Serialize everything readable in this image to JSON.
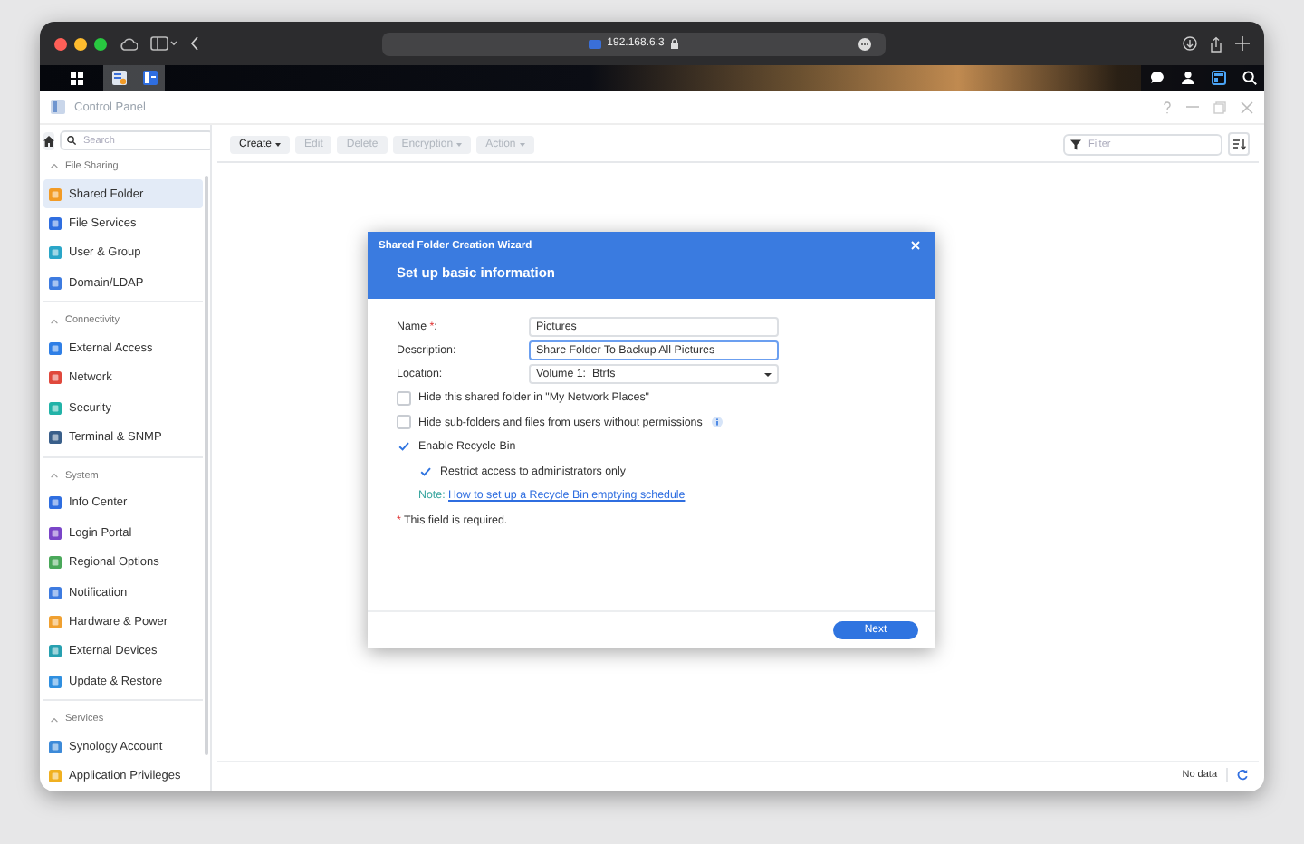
{
  "browser": {
    "address": "192.168.6.3"
  },
  "app_window": {
    "title": "Control Panel"
  },
  "sidebar": {
    "search_placeholder": "Search",
    "sections": [
      {
        "title": "File Sharing",
        "expanded": true,
        "items": [
          {
            "label": "Shared Folder",
            "selected": true
          },
          {
            "label": "File Services",
            "selected": false
          },
          {
            "label": "User & Group",
            "selected": false
          },
          {
            "label": "Domain/LDAP",
            "selected": false
          }
        ]
      },
      {
        "title": "Connectivity",
        "expanded": true,
        "items": [
          {
            "label": "External Access",
            "selected": false
          },
          {
            "label": "Network",
            "selected": false
          },
          {
            "label": "Security",
            "selected": false
          },
          {
            "label": "Terminal & SNMP",
            "selected": false
          }
        ]
      },
      {
        "title": "System",
        "expanded": true,
        "items": [
          {
            "label": "Info Center",
            "selected": false
          },
          {
            "label": "Login Portal",
            "selected": false
          },
          {
            "label": "Regional Options",
            "selected": false
          },
          {
            "label": "Notification",
            "selected": false
          },
          {
            "label": "Hardware & Power",
            "selected": false
          },
          {
            "label": "External Devices",
            "selected": false
          },
          {
            "label": "Update & Restore",
            "selected": false
          }
        ]
      },
      {
        "title": "Services",
        "expanded": true,
        "items": [
          {
            "label": "Synology Account",
            "selected": false
          },
          {
            "label": "Application Privileges",
            "selected": false
          }
        ]
      }
    ]
  },
  "toolbar": {
    "buttons": [
      {
        "label": "Create",
        "disabled": false,
        "dropdown": true
      },
      {
        "label": "Edit",
        "disabled": true,
        "dropdown": false
      },
      {
        "label": "Delete",
        "disabled": true,
        "dropdown": false
      },
      {
        "label": "Encryption",
        "disabled": true,
        "dropdown": true
      },
      {
        "label": "Action",
        "disabled": true,
        "dropdown": true
      }
    ],
    "filter_placeholder": "Filter"
  },
  "wizard": {
    "title": "Shared Folder Creation Wizard",
    "heading": "Set up basic information",
    "fields": [
      {
        "kind": "text",
        "label": "Name ",
        "required_mark": "*",
        "label_end": ":",
        "value": "Pictures",
        "focused": false
      },
      {
        "kind": "text",
        "label": "Description:",
        "value": "Share Folder To Backup All Pictures",
        "focused": true
      },
      {
        "kind": "select",
        "label": "Location:",
        "value": "Volume 1:  Btrfs",
        "focused": false
      }
    ],
    "options": [
      {
        "label": "Hide this shared folder in \"My Network Places\"",
        "checked": false,
        "info": false
      },
      {
        "label": "Hide sub-folders and files from users without permissions",
        "checked": false,
        "info": true
      },
      {
        "label": "Enable Recycle Bin",
        "checked": true,
        "info": false,
        "children": [
          {
            "label": "Restrict access to administrators only",
            "checked": true,
            "info": false
          }
        ]
      }
    ],
    "note": {
      "prefix": "Note:",
      "link": "How to set up a Recycle Bin emptying schedule"
    },
    "required_note": {
      "mark": "*",
      "text": "This field is required."
    },
    "buttons": [
      {
        "label": "Next",
        "primary": true
      }
    ]
  },
  "status_bar": {
    "text": "No data"
  }
}
